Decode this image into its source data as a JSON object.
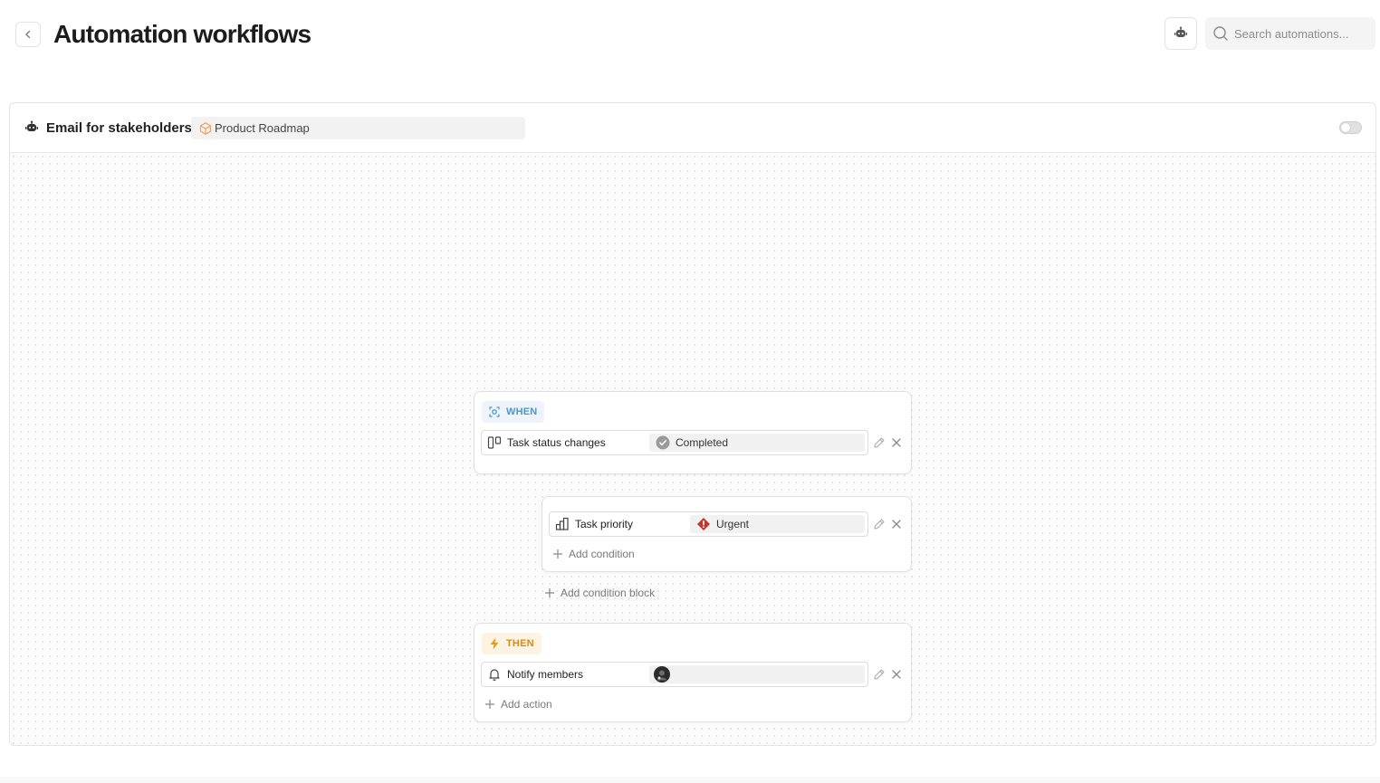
{
  "header": {
    "title": "Automation workflows",
    "search_placeholder": "Search automations..."
  },
  "workflow": {
    "name": "Email for stakeholders",
    "project": "Product Roadmap",
    "enabled": false,
    "trigger": {
      "tag": "WHEN",
      "event_label": "Task status changes",
      "value": "Completed"
    },
    "condition_block": {
      "condition_label": "Task priority",
      "value": "Urgent",
      "add_condition_label": "Add condition"
    },
    "add_condition_block_label": "Add condition block",
    "action": {
      "tag": "THEN",
      "action_label": "Notify members",
      "add_action_label": "Add action"
    }
  },
  "colors": {
    "when_accent": "#4c97d2",
    "then_accent": "#d98a14",
    "urgent": "#c0392b",
    "completed": "#9a9a9a",
    "project_icon": "#f0a060"
  }
}
